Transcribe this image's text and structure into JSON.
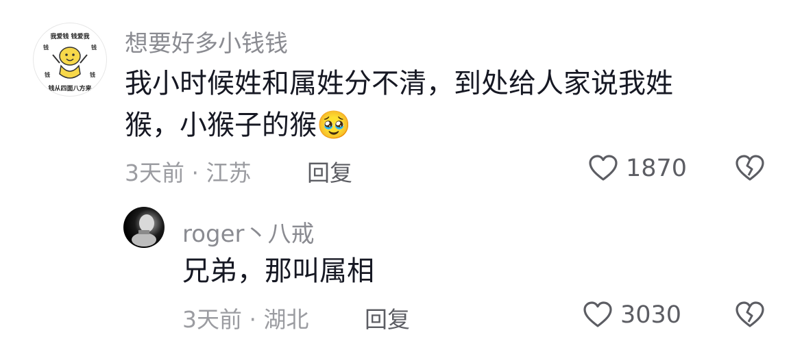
{
  "comments": [
    {
      "avatar_caption_top": "我爱钱 钱爱我",
      "avatar_caption_bottom": "钱从四面八方来",
      "avatar_coin_label": "钱",
      "username": "想要好多小钱钱",
      "text_line1": "我小时候姓和属姓分不清，到处给人家说我姓",
      "text_line2": "猴，小猴子的猴",
      "emoji": "🥹",
      "time_location": "3天前 · 江苏",
      "reply_label": "回复",
      "like_count": "1870",
      "like_icon": "heart-outline-icon",
      "dislike_icon": "broken-heart-icon"
    },
    {
      "username": "roger丶八戒",
      "text_line1": "兄弟，那叫属相",
      "time_location": "3天前 · 湖北",
      "reply_label": "回复",
      "like_count": "3030",
      "like_icon": "heart-outline-icon",
      "dislike_icon": "broken-heart-icon"
    }
  ]
}
